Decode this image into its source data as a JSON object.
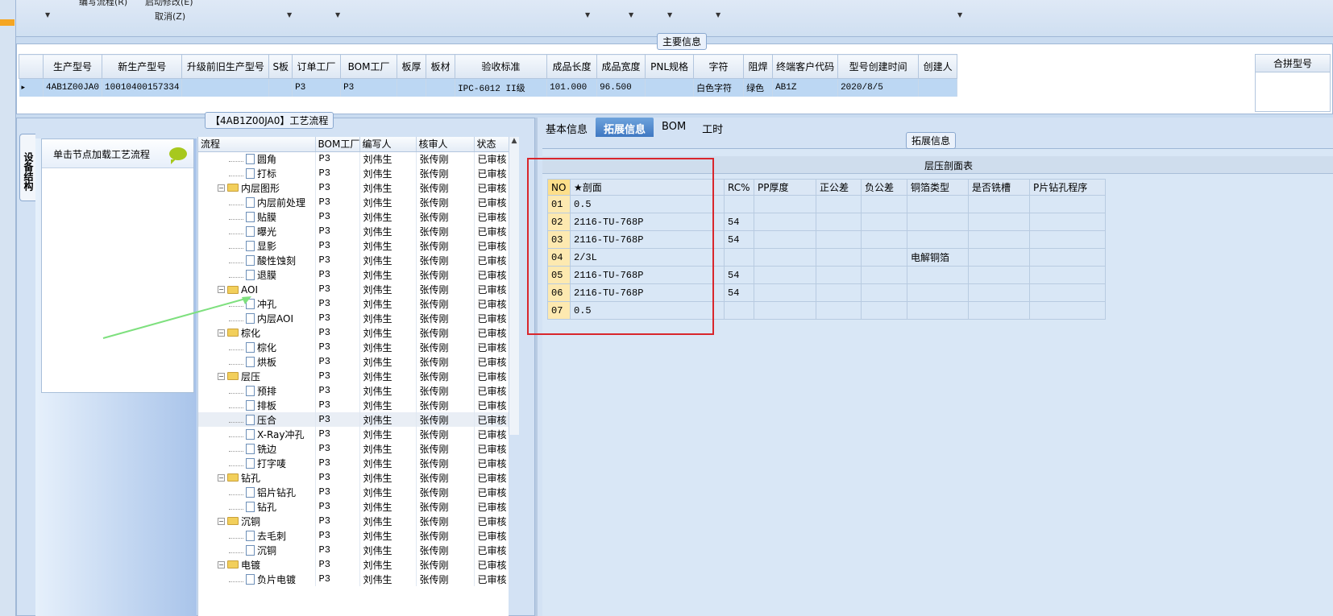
{
  "toolbar": {
    "menu1": "编写流程(R)",
    "menu2": "启动修改(E)",
    "menu3": "取消(Z)"
  },
  "main_info": {
    "title": "主要信息",
    "columns": [
      "生产型号",
      "新生产型号",
      "升级前旧生产型号",
      "S板",
      "订单工厂",
      "BOM工厂",
      "板厚",
      "板材",
      "验收标准",
      "成品长度",
      "成品宽度",
      "PNL规格",
      "字符",
      "阻焊",
      "终端客户代码",
      "型号创建时间",
      "创建人"
    ],
    "row": [
      "4AB1Z00JA0",
      "10010400157334",
      "",
      "",
      "P3",
      "P3",
      "",
      "",
      "IPC-6012 II级",
      "101.000",
      "96.500",
      "",
      "白色字符",
      "绿色",
      "AB1Z",
      "2020/8/5",
      ""
    ],
    "merge_header": "合拼型号"
  },
  "process": {
    "title": "【4AB1Z00JA0】工艺流程",
    "side_tab": "设备结构",
    "side_box_title": "单击节点加载工艺流程",
    "columns": [
      "流程",
      "BOM工厂",
      "编写人",
      "核审人",
      "状态"
    ],
    "rows": [
      {
        "name": "圆角",
        "level": 2,
        "type": "file",
        "bom": "P3",
        "writer": "刘伟生",
        "reviewer": "张传刚",
        "status": "已审核"
      },
      {
        "name": "打标",
        "level": 2,
        "type": "file",
        "bom": "P3",
        "writer": "刘伟生",
        "reviewer": "张传刚",
        "status": "已审核"
      },
      {
        "name": "内层图形",
        "level": 1,
        "type": "folder",
        "bom": "P3",
        "writer": "刘伟生",
        "reviewer": "张传刚",
        "status": "已审核"
      },
      {
        "name": "内层前处理",
        "level": 2,
        "type": "file",
        "bom": "P3",
        "writer": "刘伟生",
        "reviewer": "张传刚",
        "status": "已审核"
      },
      {
        "name": "贴膜",
        "level": 2,
        "type": "file",
        "bom": "P3",
        "writer": "刘伟生",
        "reviewer": "张传刚",
        "status": "已审核"
      },
      {
        "name": "曝光",
        "level": 2,
        "type": "file",
        "bom": "P3",
        "writer": "刘伟生",
        "reviewer": "张传刚",
        "status": "已审核"
      },
      {
        "name": "显影",
        "level": 2,
        "type": "file",
        "bom": "P3",
        "writer": "刘伟生",
        "reviewer": "张传刚",
        "status": "已审核"
      },
      {
        "name": "酸性蚀刻",
        "level": 2,
        "type": "file",
        "bom": "P3",
        "writer": "刘伟生",
        "reviewer": "张传刚",
        "status": "已审核"
      },
      {
        "name": "退膜",
        "level": 2,
        "type": "file",
        "bom": "P3",
        "writer": "刘伟生",
        "reviewer": "张传刚",
        "status": "已审核"
      },
      {
        "name": "AOI",
        "level": 1,
        "type": "folder",
        "bom": "P3",
        "writer": "刘伟生",
        "reviewer": "张传刚",
        "status": "已审核"
      },
      {
        "name": "冲孔",
        "level": 2,
        "type": "file",
        "bom": "P3",
        "writer": "刘伟生",
        "reviewer": "张传刚",
        "status": "已审核"
      },
      {
        "name": "内层AOI",
        "level": 2,
        "type": "file",
        "bom": "P3",
        "writer": "刘伟生",
        "reviewer": "张传刚",
        "status": "已审核"
      },
      {
        "name": "棕化",
        "level": 1,
        "type": "folder",
        "bom": "P3",
        "writer": "刘伟生",
        "reviewer": "张传刚",
        "status": "已审核"
      },
      {
        "name": "棕化",
        "level": 2,
        "type": "file",
        "bom": "P3",
        "writer": "刘伟生",
        "reviewer": "张传刚",
        "status": "已审核"
      },
      {
        "name": "烘板",
        "level": 2,
        "type": "file",
        "bom": "P3",
        "writer": "刘伟生",
        "reviewer": "张传刚",
        "status": "已审核"
      },
      {
        "name": "层压",
        "level": 1,
        "type": "folder",
        "bom": "P3",
        "writer": "刘伟生",
        "reviewer": "张传刚",
        "status": "已审核"
      },
      {
        "name": "预排",
        "level": 2,
        "type": "file",
        "bom": "P3",
        "writer": "刘伟生",
        "reviewer": "张传刚",
        "status": "已审核"
      },
      {
        "name": "排板",
        "level": 2,
        "type": "file",
        "bom": "P3",
        "writer": "刘伟生",
        "reviewer": "张传刚",
        "status": "已审核"
      },
      {
        "name": "压合",
        "level": 2,
        "type": "file",
        "bom": "P3",
        "writer": "刘伟生",
        "reviewer": "张传刚",
        "status": "已审核",
        "selected": true
      },
      {
        "name": "X-Ray冲孔",
        "level": 2,
        "type": "file",
        "bom": "P3",
        "writer": "刘伟生",
        "reviewer": "张传刚",
        "status": "已审核"
      },
      {
        "name": "铣边",
        "level": 2,
        "type": "file",
        "bom": "P3",
        "writer": "刘伟生",
        "reviewer": "张传刚",
        "status": "已审核"
      },
      {
        "name": "打字唛",
        "level": 2,
        "type": "file",
        "bom": "P3",
        "writer": "刘伟生",
        "reviewer": "张传刚",
        "status": "已审核"
      },
      {
        "name": "钻孔",
        "level": 1,
        "type": "folder",
        "bom": "P3",
        "writer": "刘伟生",
        "reviewer": "张传刚",
        "status": "已审核"
      },
      {
        "name": "铝片钻孔",
        "level": 2,
        "type": "file",
        "bom": "P3",
        "writer": "刘伟生",
        "reviewer": "张传刚",
        "status": "已审核"
      },
      {
        "name": "钻孔",
        "level": 2,
        "type": "file",
        "bom": "P3",
        "writer": "刘伟生",
        "reviewer": "张传刚",
        "status": "已审核"
      },
      {
        "name": "沉铜",
        "level": 1,
        "type": "folder",
        "bom": "P3",
        "writer": "刘伟生",
        "reviewer": "张传刚",
        "status": "已审核"
      },
      {
        "name": "去毛刺",
        "level": 2,
        "type": "file",
        "bom": "P3",
        "writer": "刘伟生",
        "reviewer": "张传刚",
        "status": "已审核"
      },
      {
        "name": "沉铜",
        "level": 2,
        "type": "file",
        "bom": "P3",
        "writer": "刘伟生",
        "reviewer": "张传刚",
        "status": "已审核"
      },
      {
        "name": "电镀",
        "level": 1,
        "type": "folder",
        "bom": "P3",
        "writer": "刘伟生",
        "reviewer": "张传刚",
        "status": "已审核"
      },
      {
        "name": "负片电镀",
        "level": 2,
        "type": "file",
        "bom": "P3",
        "writer": "刘伟生",
        "reviewer": "张传刚",
        "status": "已审核"
      }
    ]
  },
  "tabs": [
    "基本信息",
    "拓展信息",
    "BOM",
    "工时"
  ],
  "extended": {
    "title": "拓展信息",
    "table_title": "层压剖面表",
    "columns": [
      "NO",
      "★剖面",
      "RC%",
      "PP厚度",
      "正公差",
      "负公差",
      "铜箔类型",
      "是否铣槽",
      "P片钻孔程序"
    ],
    "rows": [
      [
        "01",
        "0.5",
        "",
        "",
        "",
        "",
        "",
        "",
        ""
      ],
      [
        "02",
        "2116-TU-768P",
        "54",
        "",
        "",
        "",
        "",
        "",
        ""
      ],
      [
        "03",
        "2116-TU-768P",
        "54",
        "",
        "",
        "",
        "",
        "",
        ""
      ],
      [
        "04",
        "2/3L",
        "",
        "",
        "",
        "",
        "电解铜箔",
        "",
        ""
      ],
      [
        "05",
        "2116-TU-768P",
        "54",
        "",
        "",
        "",
        "",
        "",
        ""
      ],
      [
        "06",
        "2116-TU-768P",
        "54",
        "",
        "",
        "",
        "",
        "",
        ""
      ],
      [
        "07",
        "0.5",
        "",
        "",
        "",
        "",
        "",
        "",
        ""
      ]
    ]
  },
  "colors": {
    "highlight_box": "#d9262c",
    "arrow": "#7ee07e",
    "active_tab": "#3f78c2"
  }
}
